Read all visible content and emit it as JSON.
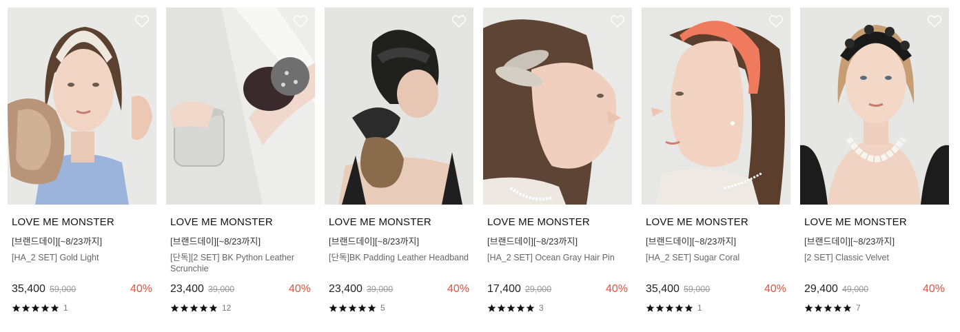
{
  "products": [
    {
      "brand": "LOVE ME MONSTER",
      "promo": "[브랜드데이][~8/23까지]",
      "name": "[HA_2 SET] Gold Light",
      "price": "35,400",
      "original_price": "59,000",
      "discount": "40%",
      "rating": 5,
      "reviews": "1",
      "photo": "woman-cream-headband-bronze-scrunchie"
    },
    {
      "brand": "LOVE ME MONSTER",
      "promo": "[브랜드데이][~8/23까지]",
      "name": "[단독][2 SET] BK Python Leather Scrunchie",
      "price": "23,400",
      "original_price": "39,000",
      "discount": "40%",
      "rating": 5,
      "reviews": "12",
      "photo": "wrist-scrunchies-glass"
    },
    {
      "brand": "LOVE ME MONSTER",
      "promo": "[브랜드데이][~8/23까지]",
      "name": "[단독]BK Padding Leather Headband",
      "price": "23,400",
      "original_price": "39,000",
      "discount": "40%",
      "rating": 5,
      "reviews": "5",
      "photo": "back-of-head-black-headband"
    },
    {
      "brand": "LOVE ME MONSTER",
      "promo": "[브랜드데이][~8/23까지]",
      "name": "[HA_2 SET] Ocean Gray Hair Pin",
      "price": "17,400",
      "original_price": "29,000",
      "discount": "40%",
      "rating": 5,
      "reviews": "3",
      "photo": "profile-gray-hair-pins"
    },
    {
      "brand": "LOVE ME MONSTER",
      "promo": "[브랜드데이][~8/23까지]",
      "name": "[HA_2 SET] Sugar Coral",
      "price": "35,400",
      "original_price": "59,000",
      "discount": "40%",
      "rating": 5,
      "reviews": "1",
      "photo": "profile-coral-headband"
    },
    {
      "brand": "LOVE ME MONSTER",
      "promo": "[브랜드데이][~8/23까지]",
      "name": "[2 SET] Classic Velvet",
      "price": "29,400",
      "original_price": "49,000",
      "discount": "40%",
      "rating": 5,
      "reviews": "7",
      "photo": "woman-black-velvet-headband-pearls"
    }
  ],
  "colors": {
    "discount": "#e8503a",
    "text": "#222222",
    "muted": "#999999"
  },
  "icons": {
    "wishlist": "heart-outline-icon",
    "rating": "star-icon"
  }
}
